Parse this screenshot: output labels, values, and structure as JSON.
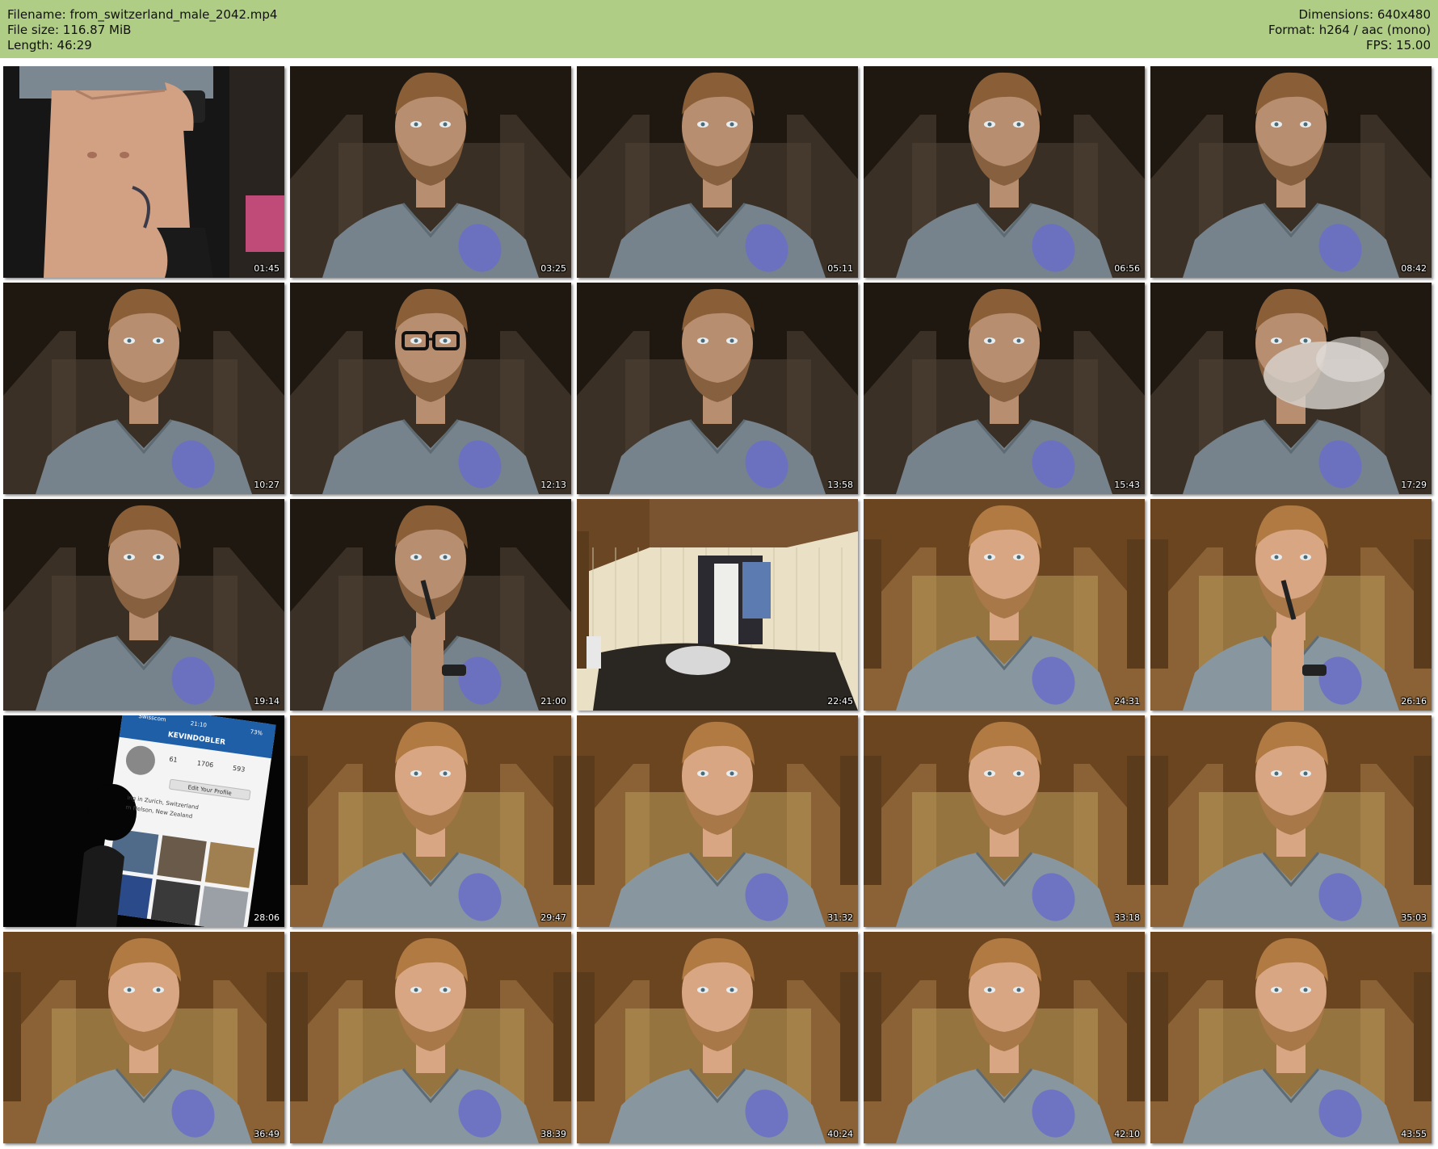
{
  "header": {
    "filename": "Filename: from_switzerland_male_2042.mp4",
    "filesize": "File size: 116.87 MiB",
    "length": "Length: 46:29",
    "dimensions": "Dimensions: 640x480",
    "format": "Format: h264 / aac (mono)",
    "fps": "FPS: 15.00"
  },
  "thumbnails": [
    {
      "timestamp": "01:45",
      "scene": "torso"
    },
    {
      "timestamp": "03:25",
      "scene": "face-dark"
    },
    {
      "timestamp": "05:11",
      "scene": "face-dark"
    },
    {
      "timestamp": "06:56",
      "scene": "face-dark"
    },
    {
      "timestamp": "08:42",
      "scene": "face-dark"
    },
    {
      "timestamp": "10:27",
      "scene": "face-dark"
    },
    {
      "timestamp": "12:13",
      "scene": "face-glasses"
    },
    {
      "timestamp": "13:58",
      "scene": "face-dark"
    },
    {
      "timestamp": "15:43",
      "scene": "face-dark"
    },
    {
      "timestamp": "17:29",
      "scene": "face-smoke"
    },
    {
      "timestamp": "19:14",
      "scene": "face-dark"
    },
    {
      "timestamp": "21:00",
      "scene": "face-vape"
    },
    {
      "timestamp": "22:45",
      "scene": "room"
    },
    {
      "timestamp": "24:31",
      "scene": "face-bright"
    },
    {
      "timestamp": "26:16",
      "scene": "face-bright-vape"
    },
    {
      "timestamp": "28:06",
      "scene": "phone"
    },
    {
      "timestamp": "29:47",
      "scene": "face-bright"
    },
    {
      "timestamp": "31:32",
      "scene": "face-bright"
    },
    {
      "timestamp": "33:18",
      "scene": "face-bright"
    },
    {
      "timestamp": "35:03",
      "scene": "face-bright"
    },
    {
      "timestamp": "36:49",
      "scene": "face-bright"
    },
    {
      "timestamp": "38:39",
      "scene": "face-bright"
    },
    {
      "timestamp": "40:24",
      "scene": "face-bright"
    },
    {
      "timestamp": "42:10",
      "scene": "face-bright"
    },
    {
      "timestamp": "43:55",
      "scene": "face-bright"
    }
  ],
  "phone_screen": {
    "carrier": "Swisscom",
    "time": "21:10",
    "battery": "73%",
    "username": "KEVINDOBLER",
    "posts": "61",
    "followers": "1706",
    "following": "593",
    "edit_profile": "Edit Your Profile",
    "bio_line1": "ing in Zurich, Switzerland",
    "bio_line2": "m Nelson, New Zealand"
  },
  "colors": {
    "header_bg": "#b0cd85",
    "shirt": "#7f8d98",
    "logo": "#6b6fc8",
    "hair": "#9a6a3a",
    "skin": "#c99a78"
  }
}
